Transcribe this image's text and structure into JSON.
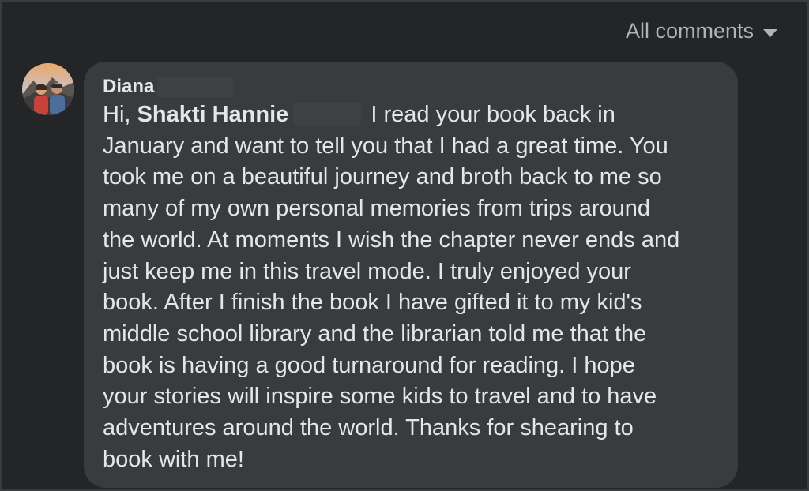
{
  "sort": {
    "label": "All comments",
    "icon": "caret-down-icon"
  },
  "comment": {
    "author": "Diana",
    "avatar_icon": "profile-photo-avatar",
    "greeting": "Hi,",
    "mention": "Shakti Hannie",
    "lines": [
      "I read your book back in",
      "January and want to tell you that I had a great time. You",
      "took me on a beautiful journey and broth back to me so",
      "many of my own personal memories from trips around",
      "the world. At moments I wish the chapter never ends and",
      "just keep me in this travel mode. I truly enjoyed your",
      "book. After I finish the book I have gifted it to my kid's",
      "middle school library and the librarian told me that the",
      "book is having a good turnaround for reading. I hope",
      "your stories will inspire some kids to travel and to have",
      "adventures around the world. Thanks for shearing to",
      "book with me!"
    ]
  },
  "colors": {
    "background": "#242526",
    "bubble": "#3a3b3c",
    "text": "#e4e6eb",
    "secondary_text": "#b0b3b8"
  }
}
